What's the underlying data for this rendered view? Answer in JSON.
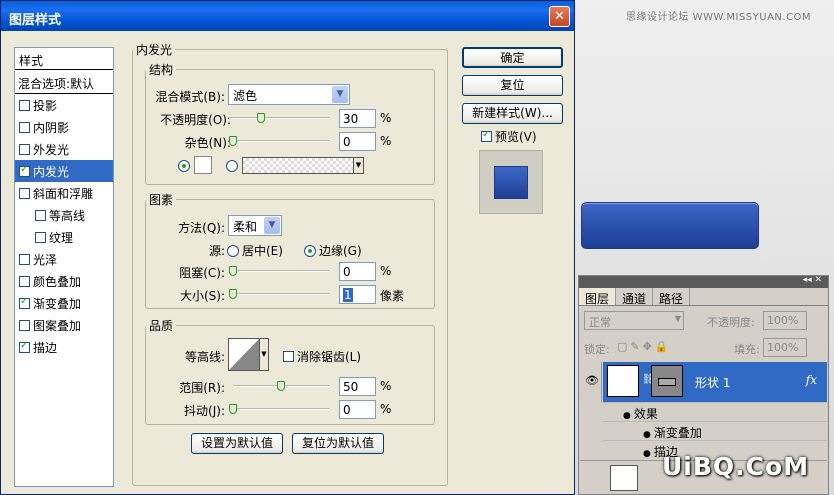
{
  "watermark_top": "思缘设计论坛 WWW.MISSYUAN.COM",
  "watermark_bottom": "UiBQ.CoM",
  "dialog": {
    "title": "图层样式",
    "close_glyph": "✕"
  },
  "style_list": {
    "header": "样式",
    "blend_options": "混合选项:默认",
    "items": [
      {
        "label": "投影",
        "checked": false
      },
      {
        "label": "内阴影",
        "checked": false
      },
      {
        "label": "外发光",
        "checked": false
      },
      {
        "label": "内发光",
        "checked": true
      },
      {
        "label": "斜面和浮雕",
        "checked": false
      },
      {
        "label": "等高线",
        "checked": false
      },
      {
        "label": "纹理",
        "checked": false
      },
      {
        "label": "光泽",
        "checked": false
      },
      {
        "label": "颜色叠加",
        "checked": false
      },
      {
        "label": "渐变叠加",
        "checked": true
      },
      {
        "label": "图案叠加",
        "checked": false
      },
      {
        "label": "描边",
        "checked": true
      }
    ]
  },
  "inner_glow": {
    "title": "内发光",
    "structure": {
      "title": "结构",
      "blend_mode_label": "混合模式(B):",
      "blend_mode_value": "滤色",
      "opacity_label": "不透明度(O):",
      "opacity_value": "30",
      "noise_label": "杂色(N):",
      "noise_value": "0",
      "percent": "%"
    },
    "elements": {
      "title": "图素",
      "method_label": "方法(Q):",
      "method_value": "柔和",
      "source_label": "源:",
      "source_center": "居中(E)",
      "source_edge": "边缘(G)",
      "choke_label": "阻塞(C):",
      "choke_value": "0",
      "size_label": "大小(S):",
      "size_value": "1",
      "size_unit": "像素",
      "percent": "%"
    },
    "quality": {
      "title": "品质",
      "contour_label": "等高线:",
      "anti_alias_label": "消除锯齿(L)",
      "range_label": "范围(R):",
      "range_value": "50",
      "jitter_label": "抖动(J):",
      "jitter_value": "0",
      "percent": "%"
    },
    "make_default": "设置为默认值",
    "reset_default": "复位为默认值"
  },
  "buttons": {
    "ok": "确定",
    "reset": "复位",
    "new_style": "新建样式(W)...",
    "preview": "预览(V)"
  },
  "layers_panel": {
    "tabs": [
      "图层",
      "通道",
      "路径"
    ],
    "blend_mode": "正常",
    "opacity_label": "不透明度:",
    "opacity_value": "100%",
    "lock_label": "锁定:",
    "fill_label": "填充:",
    "fill_value": "100%",
    "layer_name": "形状 1",
    "fx": "fx",
    "effects_label": "效果",
    "effect_items": [
      "渐变叠加",
      "描边"
    ]
  }
}
